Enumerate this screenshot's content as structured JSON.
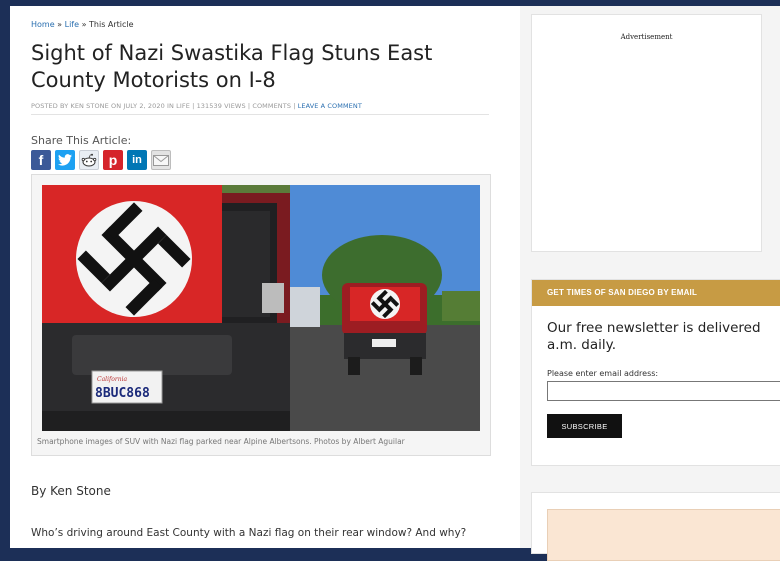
{
  "breadcrumb": {
    "home": "Home",
    "sep": " » ",
    "section": "Life",
    "current": "This Article"
  },
  "article": {
    "title": "Sight of Nazi Swastika Flag Stuns East County Motorists on I-8",
    "meta": {
      "posted_by_prefix": "Posted by ",
      "author": "Ken Stone",
      "on_date": " on July 2, 2020 in ",
      "category": "Life",
      "views": " | 131539 Views | ",
      "comments": "Comments",
      "pipe": " | ",
      "leave_comment": "Leave a Comment"
    },
    "share_label": "Share This Article:",
    "share_icons": [
      "facebook-icon",
      "twitter-icon",
      "reddit-icon",
      "pinterest-icon",
      "linkedin-icon",
      "email-icon"
    ],
    "image": {
      "plate": "8BUC868",
      "plate_state": "California"
    },
    "caption": "Smartphone images of SUV with Nazi flag parked near Alpine Albertsons. Photos by Albert Aguilar",
    "byline": "By Ken Stone",
    "first_paragraph": "Who’s driving around East County with a Nazi flag on their rear window? And why?"
  },
  "sidebar": {
    "ad_label": "Advertisement",
    "newsletter": {
      "heading": "Get Times of San Diego by Email",
      "description_line1": "Our free newsletter is delivered",
      "description_line2": "a.m. daily.",
      "email_label": "Please enter email address:",
      "email_value": "",
      "subscribe_label": "Subscribe"
    }
  },
  "colors": {
    "page_bg": "#1c2f57",
    "link": "#2a6fb0",
    "newsletter_header": "#c79b44",
    "button": "#111111"
  }
}
